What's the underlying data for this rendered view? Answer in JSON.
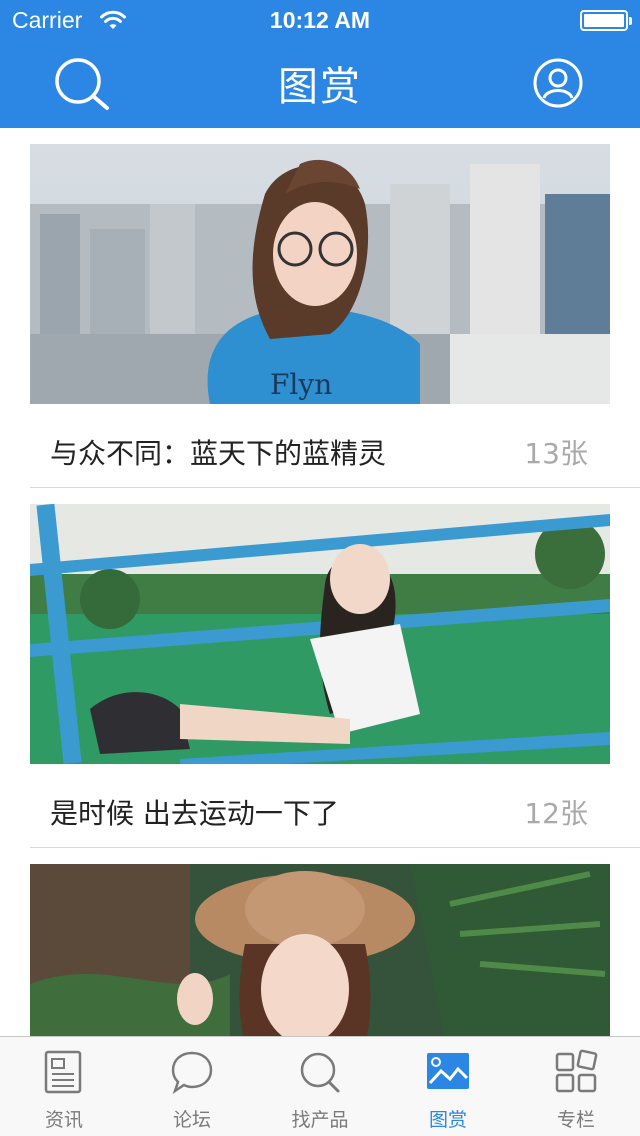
{
  "status_bar": {
    "carrier": "Carrier",
    "time": "10:12 AM"
  },
  "nav": {
    "title": "图赏",
    "left_icon": "search-icon",
    "right_icon": "user-icon"
  },
  "colors": {
    "brand": "#2b87e3",
    "tab_inactive": "#7a7a7a",
    "count_text": "#a9a9a9"
  },
  "feed": [
    {
      "title": "与众不同：蓝天下的蓝精灵",
      "count": "13张"
    },
    {
      "title": "是时候 出去运动一下了",
      "count": "12张"
    },
    {
      "title": "",
      "count": ""
    }
  ],
  "tabs": [
    {
      "label": "资讯",
      "icon": "news-icon",
      "active": false
    },
    {
      "label": "论坛",
      "icon": "chat-icon",
      "active": false
    },
    {
      "label": "找产品",
      "icon": "search-icon",
      "active": false
    },
    {
      "label": "图赏",
      "icon": "image-icon",
      "active": true
    },
    {
      "label": "专栏",
      "icon": "grid-icon",
      "active": false
    }
  ]
}
